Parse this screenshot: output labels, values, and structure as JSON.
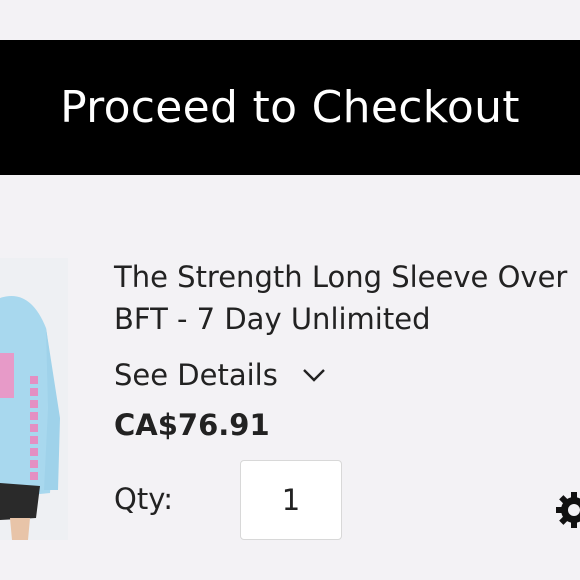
{
  "cart": {
    "checkout_label": "Proceed to Checkout",
    "item": {
      "title_line1": "The Strength Long Sleeve Over",
      "title_line2": "BFT - 7 Day Unlimited",
      "details_label": "See Details",
      "details_icon": "chevron-down-icon",
      "price": "CA$76.91",
      "qty_label": "Qty:",
      "qty_value": "1",
      "settings_icon": "gear-icon"
    }
  },
  "colors": {
    "page_bg": "#f3f2f5",
    "checkout_bg": "#000000",
    "checkout_text": "#ffffff",
    "text": "#222222",
    "shirt": "#a8d8ee"
  }
}
